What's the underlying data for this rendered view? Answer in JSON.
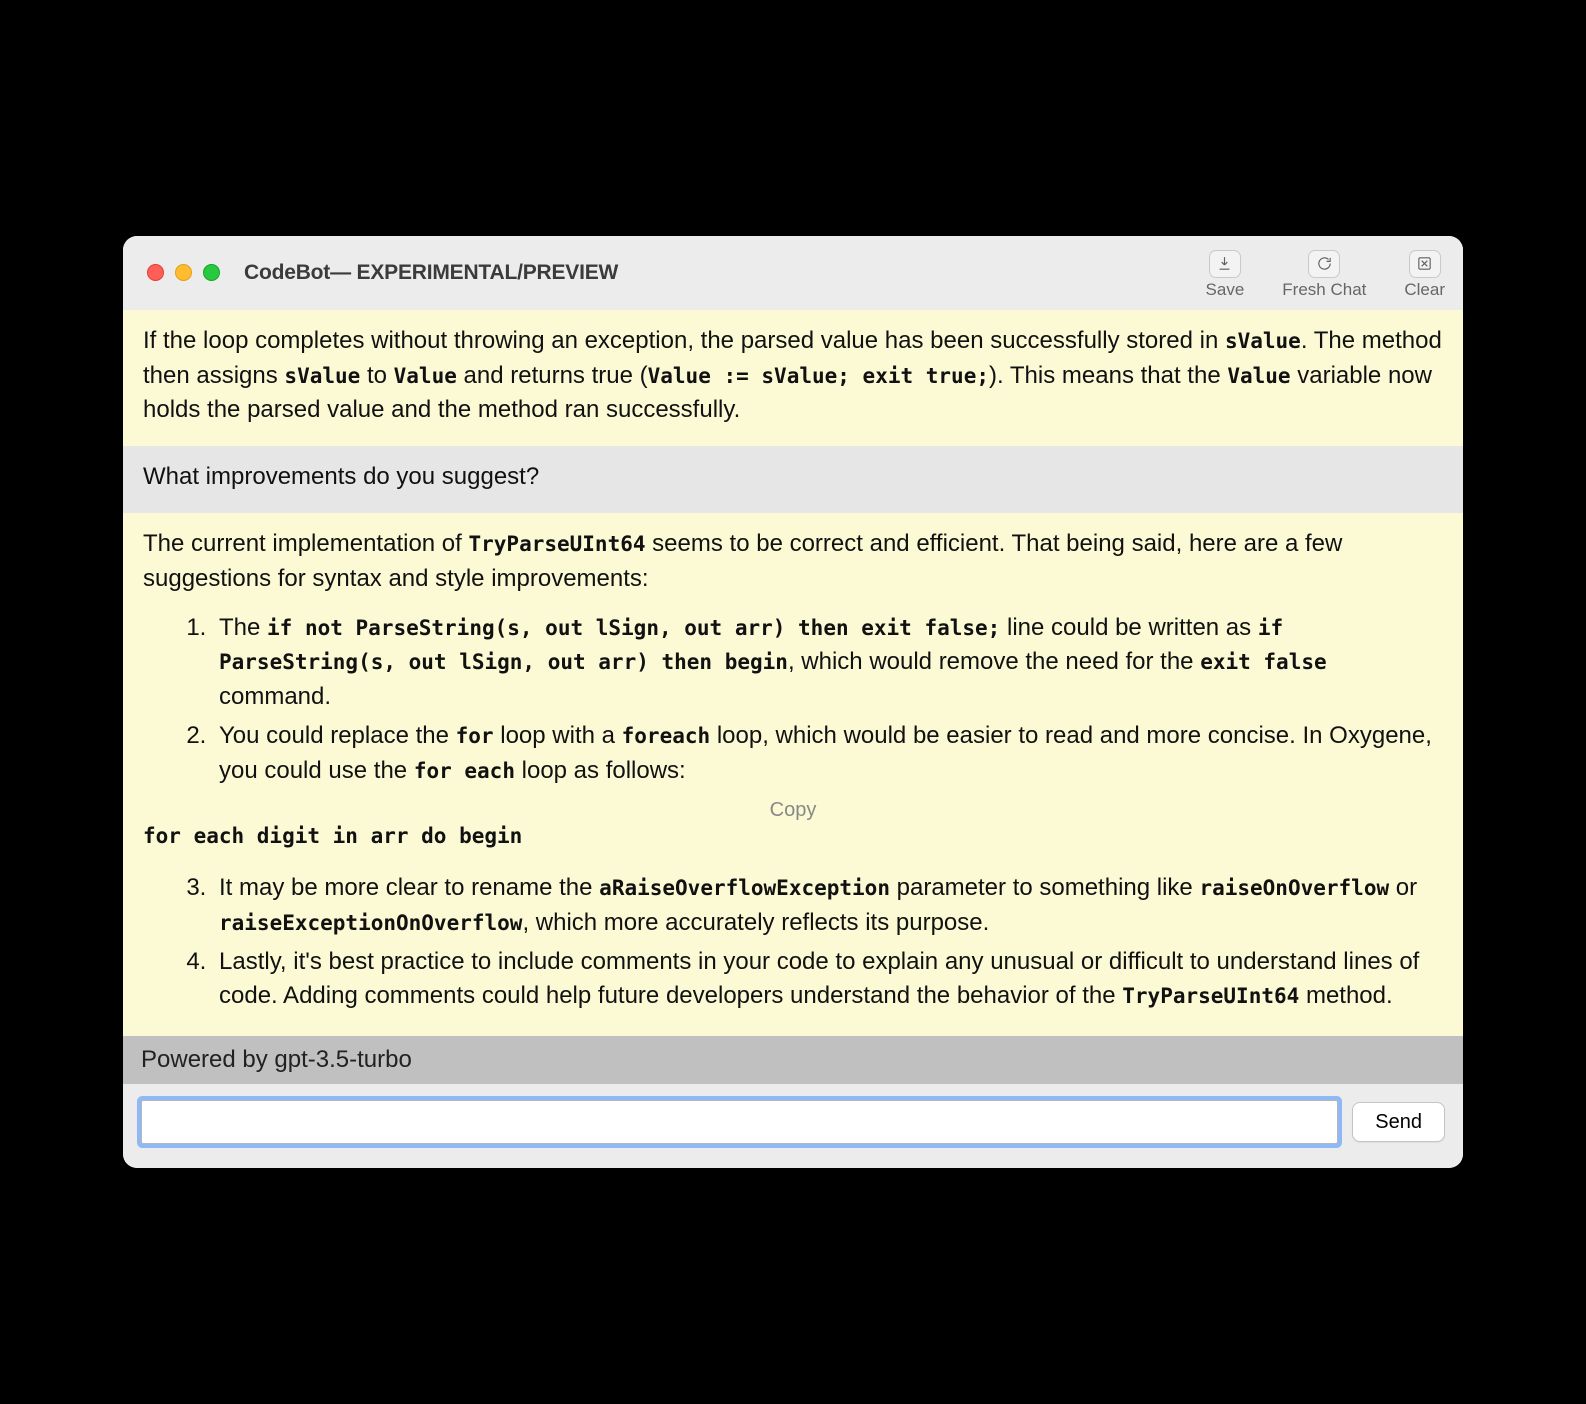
{
  "window": {
    "title": "CodeBot— EXPERIMENTAL/PREVIEW"
  },
  "toolbar": {
    "save": {
      "label": "Save"
    },
    "fresh": {
      "label": "Fresh Chat"
    },
    "clear": {
      "label": "Clear"
    }
  },
  "chat": {
    "m0": {
      "p0_a": "If the loop completes without throwing an exception, the parsed value has been successfully stored in ",
      "p0_c1": "sValue",
      "p0_b": ". The method then assigns ",
      "p0_c2": "sValue",
      "p0_c": " to ",
      "p0_c3": "Value",
      "p0_d": " and returns true (",
      "p0_c4": "Value := sValue; exit true;",
      "p0_e": "). This means that the ",
      "p0_c5": "Value",
      "p0_f": " variable now holds the parsed value and the method ran successfully."
    },
    "m1": {
      "text": "What improvements do you suggest?"
    },
    "m2": {
      "intro_a": "The current implementation of ",
      "intro_c1": "TryParseUInt64",
      "intro_b": " seems to be correct and efficient. That being said, here are a few suggestions for syntax and style improvements:",
      "li1_a": "The ",
      "li1_c1": "if not ParseString(s, out lSign, out arr) then exit false;",
      "li1_b": " line could be written as ",
      "li1_c2": "if ParseString(s, out lSign, out arr) then begin",
      "li1_c": ", which would remove the need for the ",
      "li1_c3": "exit false",
      "li1_d": " command.",
      "li2_a": "You could replace the ",
      "li2_c1": "for",
      "li2_b": " loop with a ",
      "li2_c2": "foreach",
      "li2_c": " loop, which would be easier to read and more concise. In Oxygene, you could use the ",
      "li2_c3": "for each",
      "li2_d": " loop as follows:",
      "code": "for each digit in arr do begin",
      "copy_label": "Copy",
      "li3_a": "It may be more clear to rename the ",
      "li3_c1": "aRaiseOverflowException",
      "li3_b": " parameter to something like ",
      "li3_c2": "raiseOnOverflow",
      "li3_c": " or ",
      "li3_c3": "raiseExceptionOnOverflow",
      "li3_d": ", which more accurately reflects its purpose.",
      "li4_a": "Lastly, it's best practice to include comments in your code to explain any unusual or difficult to understand lines of code. Adding comments could help future developers understand the behavior of the ",
      "li4_c1": "TryParseUInt64",
      "li4_b": " method."
    }
  },
  "status": {
    "text": "Powered by gpt-3.5-turbo"
  },
  "input": {
    "value": "",
    "placeholder": "",
    "send_label": "Send"
  }
}
